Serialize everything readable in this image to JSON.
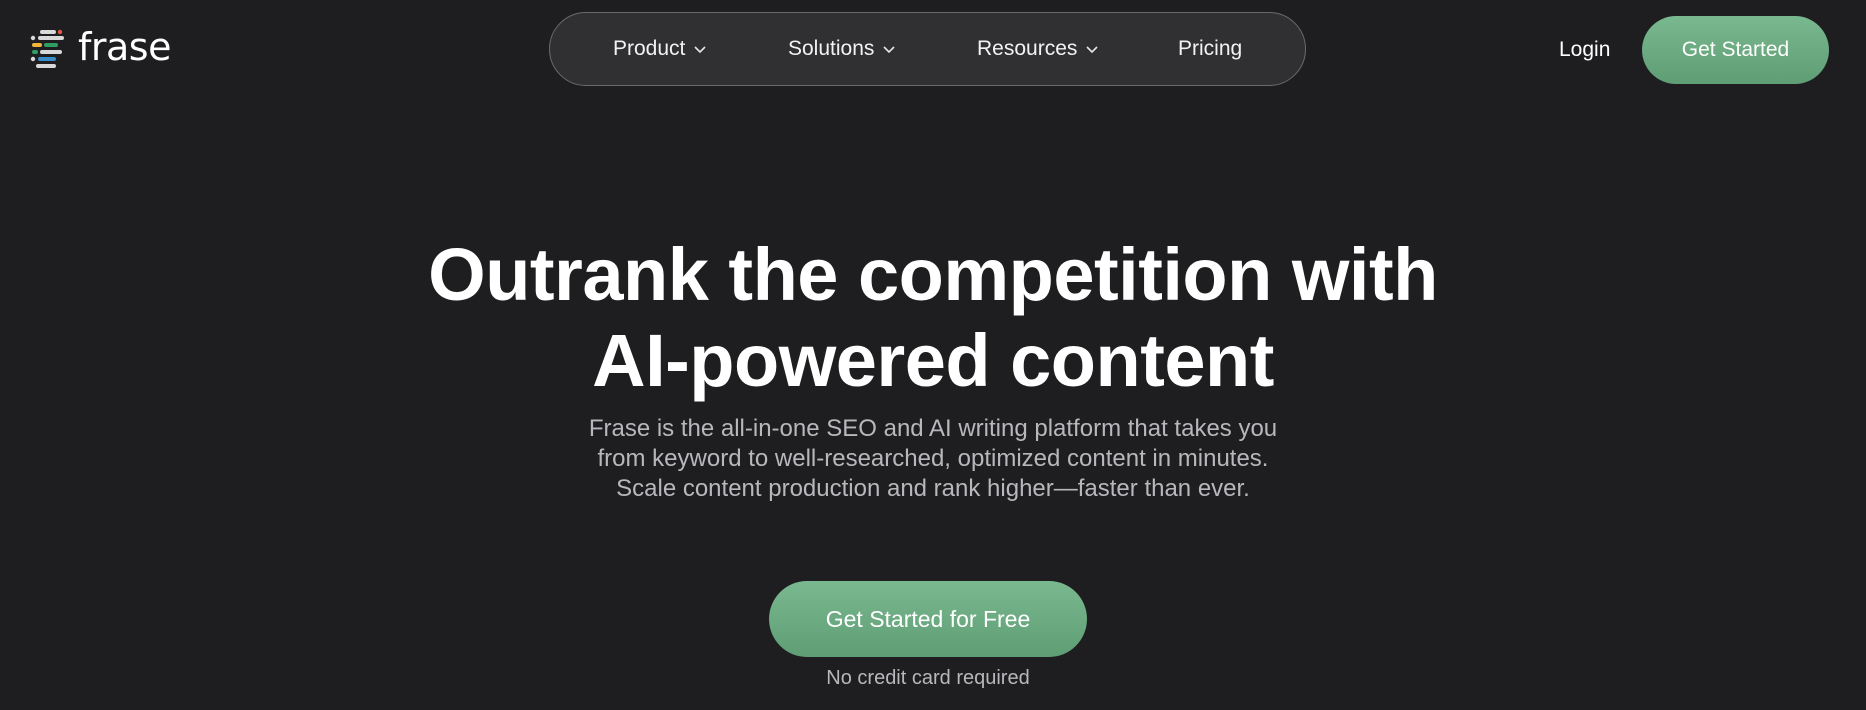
{
  "header": {
    "logo_text": "frase",
    "nav": [
      {
        "label": "Product",
        "has_dropdown": true
      },
      {
        "label": "Solutions",
        "has_dropdown": true
      },
      {
        "label": "Resources",
        "has_dropdown": true
      },
      {
        "label": "Pricing",
        "has_dropdown": false
      }
    ],
    "login_label": "Login",
    "cta_label": "Get Started"
  },
  "hero": {
    "title_line1": "Outrank the competition with",
    "title_line2": "AI-powered content",
    "subtitle_lines": [
      "Frase is the all-in-one SEO and AI writing platform that takes you",
      "from keyword to well-researched, optimized content in minutes.",
      "Scale content production and rank higher—faster than ever."
    ],
    "cta_label": "Get Started for Free",
    "note": "No credit card required"
  },
  "colors": {
    "background": "#1e1e20",
    "nav_pill": "#303033",
    "accent_green": "#6dab82",
    "muted_text": "#b8b8bc"
  },
  "icons": {
    "logo_mark": "frase-logo-icon",
    "dropdown": "chevron-down-icon"
  }
}
